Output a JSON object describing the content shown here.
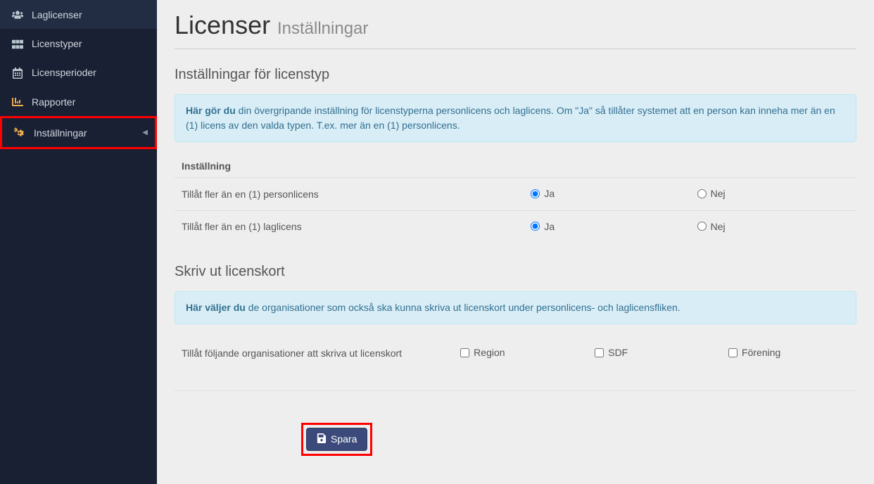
{
  "sidebar": {
    "items": [
      {
        "label": "Laglicenser",
        "icon": "users-icon"
      },
      {
        "label": "Licenstyper",
        "icon": "grid-icon"
      },
      {
        "label": "Licensperioder",
        "icon": "calendar-icon"
      },
      {
        "label": "Rapporter",
        "icon": "chart-icon"
      },
      {
        "label": "Inställningar",
        "icon": "cogs-icon",
        "highlighted": true
      }
    ]
  },
  "header": {
    "title": "Licenser",
    "subtitle": "Inställningar"
  },
  "section1": {
    "title": "Inställningar för licenstyp",
    "info_strong": "Här gör du",
    "info_rest": " din övergripande inställning för licenstyperna personlicens och laglicens. Om \"Ja\" så tillåter systemet att en person kan inneha mer än en (1) licens av den valda typen. T.ex. mer än en (1) personlicens.",
    "col_header": "Inställning",
    "rows": [
      {
        "label": "Tillåt fler än en (1) personlicens",
        "yes": "Ja",
        "no": "Nej",
        "selected": "yes"
      },
      {
        "label": "Tillåt fler än en (1) laglicens",
        "yes": "Ja",
        "no": "Nej",
        "selected": "yes"
      }
    ]
  },
  "section2": {
    "title": "Skriv ut licenskort",
    "info_strong": "Här väljer du",
    "info_rest": " de organisationer som också ska kunna skriva ut licenskort under personlicens- och laglicensfliken.",
    "row_label": "Tillåt följande organisationer att skriva ut licenskort",
    "options": [
      {
        "label": "Region",
        "checked": false
      },
      {
        "label": "SDF",
        "checked": false
      },
      {
        "label": "Förening",
        "checked": false
      }
    ]
  },
  "save": {
    "label": "Spara"
  }
}
